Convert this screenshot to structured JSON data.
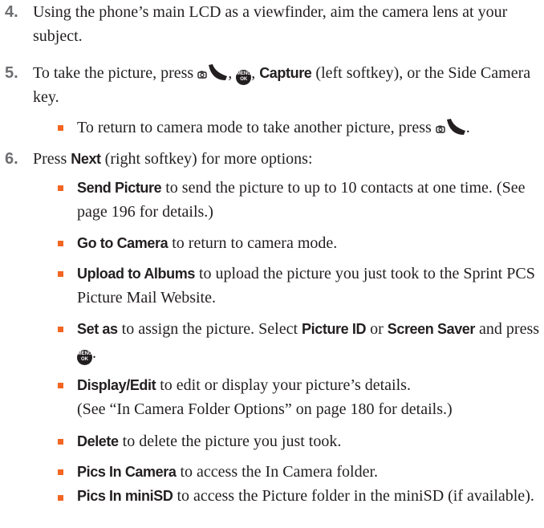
{
  "steps": {
    "s4": {
      "num": "4.",
      "text": "Using the phone’s main LCD as a viewfinder, aim the camera lens at your subject."
    },
    "s5": {
      "num": "5.",
      "pre": "To take the picture, press ",
      "sep": ", ",
      "capture": "Capture",
      "post": " (left softkey), or the Side Camera key."
    },
    "s5b": {
      "text": "To return to camera mode to take another picture, press ",
      "end": "."
    },
    "s6": {
      "num": "6.",
      "pre": "Press ",
      "next": "Next",
      "post": " (right softkey) for more options:"
    }
  },
  "options": {
    "send": {
      "kw": "Send Picture",
      "text": " to send the picture to up to 10 contacts at one time. (See page 196 for details.)"
    },
    "goto": {
      "kw": "Go to Camera",
      "text": " to return to camera mode."
    },
    "upload": {
      "kw": "Upload to Albums",
      "text": " to upload the picture you just took to the Sprint PCS Picture Mail Website."
    },
    "setas": {
      "kw": "Set as",
      "text1": " to assign the picture. Select ",
      "kw2": "Picture ID",
      "text2": " or ",
      "kw3": "Screen Saver",
      "text3": " and press ",
      "end": "."
    },
    "display": {
      "kw": "Display/Edit",
      "text1": " to edit or display your picture’s details.",
      "text2": "(See “In Camera Folder Options” on page 180 for details.)"
    },
    "delete": {
      "kw": "Delete",
      "text": " to delete the picture you just took."
    },
    "pics_camera": {
      "kw": "Pics In Camera",
      "text": " to access the In Camera folder."
    },
    "pics_minisd": {
      "kw": "Pics In miniSD",
      "text": " to access the Picture folder in the miniSD (if available)."
    }
  },
  "icons": {
    "camera_key": "camera-key-icon",
    "menu_ok": "menu-ok-key-icon",
    "menu_label": "MENU",
    "ok_label": "OK"
  },
  "colors": {
    "bullet": "#f26522",
    "step_number": "#6d6e71",
    "text": "#231f20"
  }
}
